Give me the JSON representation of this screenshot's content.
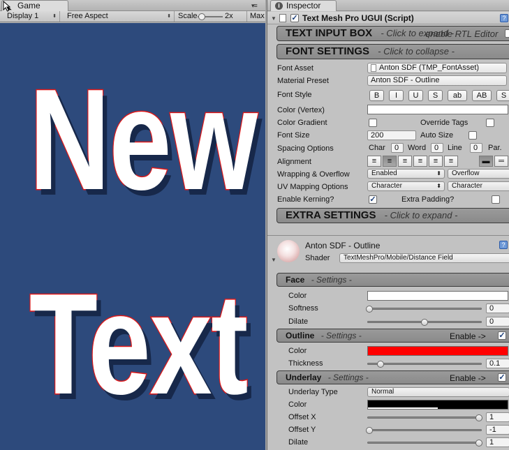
{
  "game": {
    "tab_label": "Game",
    "display": "Display 1",
    "aspect": "Free Aspect",
    "scale_label": "Scale",
    "scale_value": "2x",
    "maximize": "Max",
    "line1": "New",
    "line2": "Text"
  },
  "inspector": {
    "tab_label": "Inspector",
    "component_title": "Text Mesh Pro UGUI (Script)",
    "component_enabled": true,
    "text_input": {
      "title": "TEXT INPUT BOX",
      "hint": "- Click to expand -",
      "overlay": "enable RTL Editor"
    },
    "font_settings": {
      "title": "FONT SETTINGS",
      "hint": "- Click to collapse -"
    },
    "labels": {
      "font_asset": "Font Asset",
      "material_preset": "Material Preset",
      "font_style": "Font Style",
      "color_vertex": "Color (Vertex)",
      "color_gradient": "Color Gradient",
      "override_tags": "Override Tags",
      "font_size": "Font Size",
      "auto_size": "Auto Size",
      "spacing": "Spacing Options",
      "alignment": "Alignment",
      "wrapping": "Wrapping & Overflow",
      "uv_mapping": "UV Mapping Options",
      "kerning": "Enable Kerning?",
      "extra_padding": "Extra Padding?"
    },
    "values": {
      "font_asset": "Anton SDF (TMP_FontAsset)",
      "material_preset": "Anton SDF - Outline",
      "font_size": "200",
      "spacing_char_label": "Char",
      "spacing_char": "0",
      "spacing_word_label": "Word",
      "spacing_word": "0",
      "spacing_line_label": "Line",
      "spacing_line": "0",
      "spacing_par_label": "Par.",
      "wrapping": "Enabled",
      "overflow": "Overflow",
      "uv_h": "Character",
      "uv_v": "Character",
      "color_gradient_checked": false,
      "override_tags_checked": false,
      "auto_size_checked": false,
      "kerning_checked": true,
      "extra_padding_checked": false
    },
    "style_buttons": [
      "B",
      "I",
      "U",
      "S",
      "ab",
      "AB",
      "S"
    ],
    "extra_settings": {
      "title": "EXTRA SETTINGS",
      "hint": "- Click to expand -"
    },
    "material": {
      "name": "Anton SDF - Outline",
      "shader_label": "Shader",
      "shader": "TextMeshPro/Mobile/Distance Field"
    },
    "face": {
      "title": "Face",
      "subtitle": "- Settings -",
      "color_label": "Color",
      "color": "#ffffff",
      "softness_label": "Softness",
      "softness": "0",
      "dilate_label": "Dilate",
      "dilate": "0"
    },
    "outline": {
      "title": "Outline",
      "subtitle": "- Settings -",
      "enable_label": "Enable ->",
      "enabled": true,
      "color_label": "Color",
      "color": "#ff0000",
      "thickness_label": "Thickness",
      "thickness": "0.1"
    },
    "underlay": {
      "title": "Underlay",
      "subtitle": "- Settings -",
      "enable_label": "Enable ->",
      "enabled": true,
      "type_label": "Underlay Type",
      "type": "Normal",
      "color_label": "Color",
      "color": "#000000",
      "offset_x_label": "Offset X",
      "offset_x": "1",
      "offset_y_label": "Offset Y",
      "offset_y": "-1",
      "dilate_label": "Dilate",
      "dilate": "1"
    },
    "slider_levels": {
      "face_softness": 0.0,
      "face_dilate": 0.5,
      "outline_thickness": 0.1,
      "underlay_offset_x": 1.0,
      "underlay_offset_y": 0.0,
      "underlay_dilate": 1.0
    }
  },
  "colors": {
    "viewport_bg": "#2d4a7c",
    "text_outline": "#e01818",
    "text_shadow": "#17284a",
    "inspector_bg": "#c2c2c2"
  }
}
